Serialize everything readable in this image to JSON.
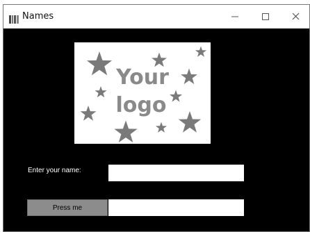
{
  "window": {
    "title": "Names"
  },
  "titlebar": {
    "app_icon": "window-app-icon",
    "minimize_icon": "minimize-icon",
    "maximize_icon": "maximize-icon",
    "close_icon": "close-icon"
  },
  "logo": {
    "line1": "Your",
    "line2": "logo",
    "decoration": "star-icon",
    "text_color": "#8a8a8a"
  },
  "form": {
    "name_label": "Enter your name:",
    "name_value": "",
    "button_label": "Press me",
    "output_value": ""
  }
}
